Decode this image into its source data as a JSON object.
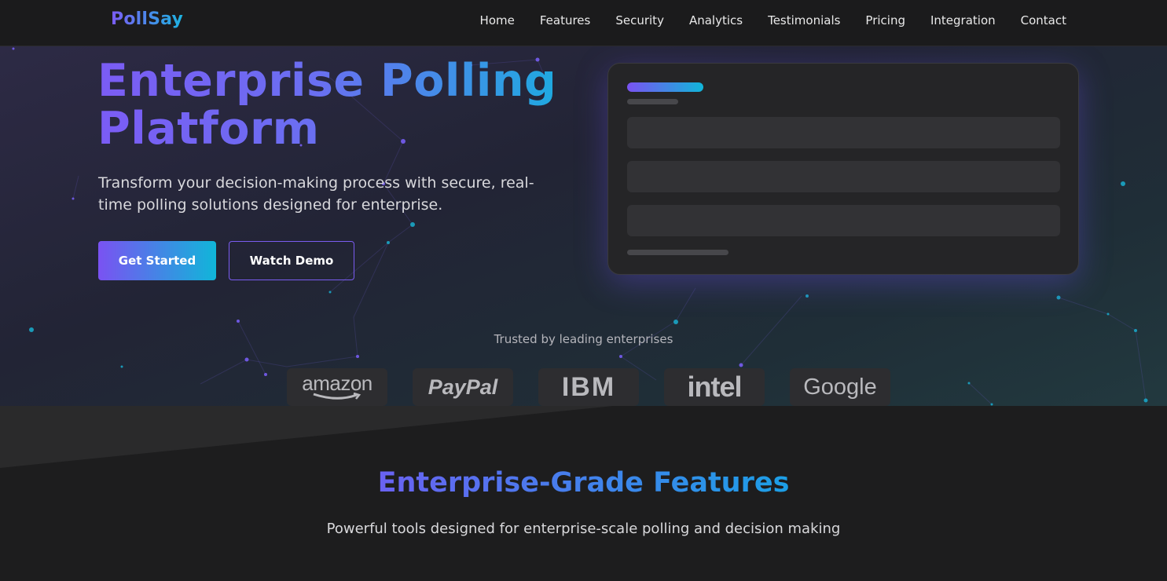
{
  "nav": {
    "brand": "PollSay",
    "items": [
      "Home",
      "Features",
      "Security",
      "Analytics",
      "Testimonials",
      "Pricing",
      "Integration",
      "Contact"
    ]
  },
  "hero": {
    "title": "Enterprise Polling Platform",
    "subtitle": "Transform your decision-making process with secure, real-time polling solutions designed for enterprise.",
    "primary_cta": "Get Started",
    "secondary_cta": "Watch Demo",
    "trusted_label": "Trusted by leading enterprises",
    "logos": [
      "amazon",
      "PayPal",
      "IBM",
      "intel",
      "Google"
    ]
  },
  "features": {
    "title": "Enterprise-Grade Features",
    "subtitle": "Powerful tools designed for enterprise-scale polling and decision making"
  },
  "colors": {
    "accent_purple": "#7a52f2",
    "accent_cyan": "#10b6d9",
    "background": "#1c1c1d"
  }
}
